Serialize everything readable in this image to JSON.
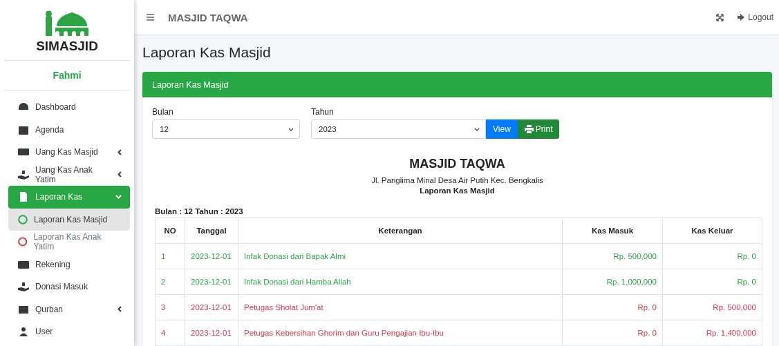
{
  "brand": {
    "name": "SIMASJID"
  },
  "user": {
    "name": "Fahmi"
  },
  "sidebar": {
    "items": [
      {
        "label": "Dashboard",
        "selected": false
      },
      {
        "label": "Agenda",
        "selected": false
      },
      {
        "label": "Uang Kas Masjid",
        "selected": false,
        "expanded": false
      },
      {
        "label": "Uang Kas Anak Yatim",
        "selected": false,
        "expanded": false
      },
      {
        "label": "Laporan Kas",
        "selected": true,
        "expanded": true,
        "children": [
          {
            "label": "Laporan Kas Masjid",
            "selected": true,
            "color": "#28a745"
          },
          {
            "label": "Laporan Kas Anak Yatim",
            "selected": false,
            "color": "#dc3545"
          }
        ]
      },
      {
        "label": "Rekening",
        "selected": false
      },
      {
        "label": "Donasi Masuk",
        "selected": false
      },
      {
        "label": "Qurban",
        "selected": false,
        "expanded": false
      },
      {
        "label": "User",
        "selected": false
      }
    ]
  },
  "topbar": {
    "title": "MASJID TAQWA",
    "logout": "Logout"
  },
  "page_title": "Laporan Kas Masjid",
  "card": {
    "title": "Laporan Kas Masjid",
    "filters": [
      {
        "label": "Bulan",
        "value": "12"
      },
      {
        "label": "Tahun",
        "value": "2023"
      }
    ],
    "buttons": [
      "View",
      "Print"
    ],
    "report": {
      "title": "MASJID TAQWA",
      "address": "Jl. Panglima Minal Desa Air Putih Kec. Bengkalis",
      "subtitle": "Laporan Kas Masjid",
      "period": "Bulan : 12 Tahun : 2023"
    },
    "table": {
      "columns": [
        "NO",
        "Tanggal",
        "Keterangan",
        "Kas Masuk",
        "Kas Keluar"
      ],
      "rows": [
        {
          "kind": "income",
          "cells": [
            "1",
            "2023-12-01",
            "Infak Donasi dari Bapak Almi",
            "Rp. 500,000",
            "Rp. 0"
          ]
        },
        {
          "kind": "income",
          "cells": [
            "2",
            "2023-12-01",
            "Infak Donasi dari Hamba Allah",
            "Rp. 1,000,000",
            "Rp. 0"
          ]
        },
        {
          "kind": "expense",
          "cells": [
            "3",
            "2023-12-01",
            "Petugas Sholat Jum'at",
            "Rp. 0",
            "Rp. 500,000"
          ]
        },
        {
          "kind": "expense",
          "cells": [
            "4",
            "2023-12-01",
            "Petugas Kebersihan Ghorim dan Guru Pengajian Ibu-Ibu",
            "Rp. 0",
            "Rp. 1,400,000"
          ]
        }
      ]
    }
  }
}
